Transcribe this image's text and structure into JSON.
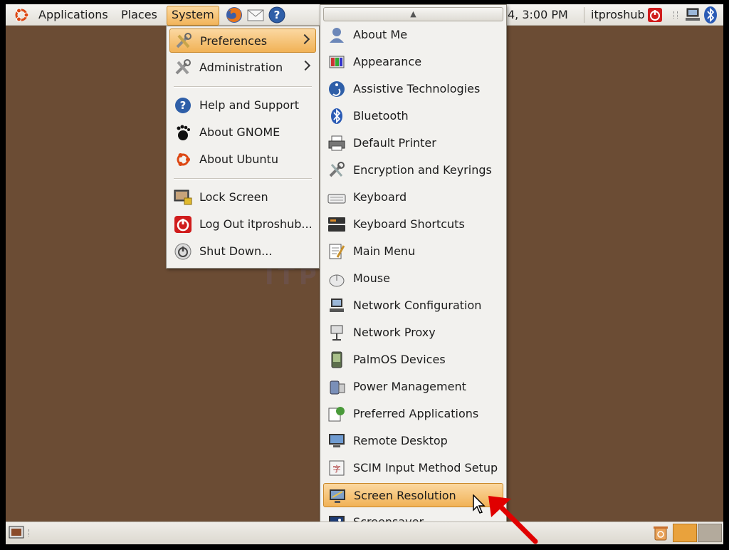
{
  "colors": {
    "desktop": "#6b4c34",
    "highlight": "#f4b85f",
    "accent_red": "#e00000"
  },
  "top_panel": {
    "applications": "Applications",
    "places": "Places",
    "system": "System",
    "clock": "4,  3:00 PM",
    "user": "itproshub",
    "launchers": [
      "firefox-icon",
      "mail-icon",
      "help-icon"
    ],
    "tray": [
      "network-icon",
      "bluetooth-icon"
    ]
  },
  "system_menu": {
    "items": [
      {
        "label": "Preferences",
        "icon": "preferences-icon",
        "submenu": true,
        "highlighted": true
      },
      {
        "label": "Administration",
        "icon": "administration-icon",
        "submenu": true
      },
      {
        "label": "Help and Support",
        "icon": "help-icon"
      },
      {
        "label": "About GNOME",
        "icon": "gnome-foot-icon"
      },
      {
        "label": "About Ubuntu",
        "icon": "ubuntu-logo-icon"
      },
      {
        "label": "Lock Screen",
        "icon": "lock-screen-icon"
      },
      {
        "label": "Log Out itproshub...",
        "icon": "logout-icon"
      },
      {
        "label": "Shut Down...",
        "icon": "shutdown-icon"
      }
    ]
  },
  "preferences_menu": {
    "items": [
      {
        "label": "About Me",
        "icon": "about-me-icon"
      },
      {
        "label": "Appearance",
        "icon": "appearance-icon"
      },
      {
        "label": "Assistive Technologies",
        "icon": "accessibility-icon"
      },
      {
        "label": "Bluetooth",
        "icon": "bluetooth-icon"
      },
      {
        "label": "Default Printer",
        "icon": "printer-icon"
      },
      {
        "label": "Encryption and Keyrings",
        "icon": "keyring-icon"
      },
      {
        "label": "Keyboard",
        "icon": "keyboard-icon"
      },
      {
        "label": "Keyboard Shortcuts",
        "icon": "keyboard-shortcuts-icon"
      },
      {
        "label": "Main Menu",
        "icon": "main-menu-icon"
      },
      {
        "label": "Mouse",
        "icon": "mouse-icon"
      },
      {
        "label": "Network Configuration",
        "icon": "network-config-icon"
      },
      {
        "label": "Network Proxy",
        "icon": "network-proxy-icon"
      },
      {
        "label": "PalmOS Devices",
        "icon": "palm-device-icon"
      },
      {
        "label": "Power Management",
        "icon": "power-management-icon"
      },
      {
        "label": "Preferred Applications",
        "icon": "preferred-apps-icon"
      },
      {
        "label": "Remote Desktop",
        "icon": "remote-desktop-icon"
      },
      {
        "label": "SCIM Input Method Setup",
        "icon": "scim-icon"
      },
      {
        "label": "Screen Resolution",
        "icon": "screen-resolution-icon",
        "highlighted": true
      },
      {
        "label": "Screensaver",
        "icon": "screensaver-icon"
      }
    ]
  },
  "watermark": "ITPROHUB"
}
